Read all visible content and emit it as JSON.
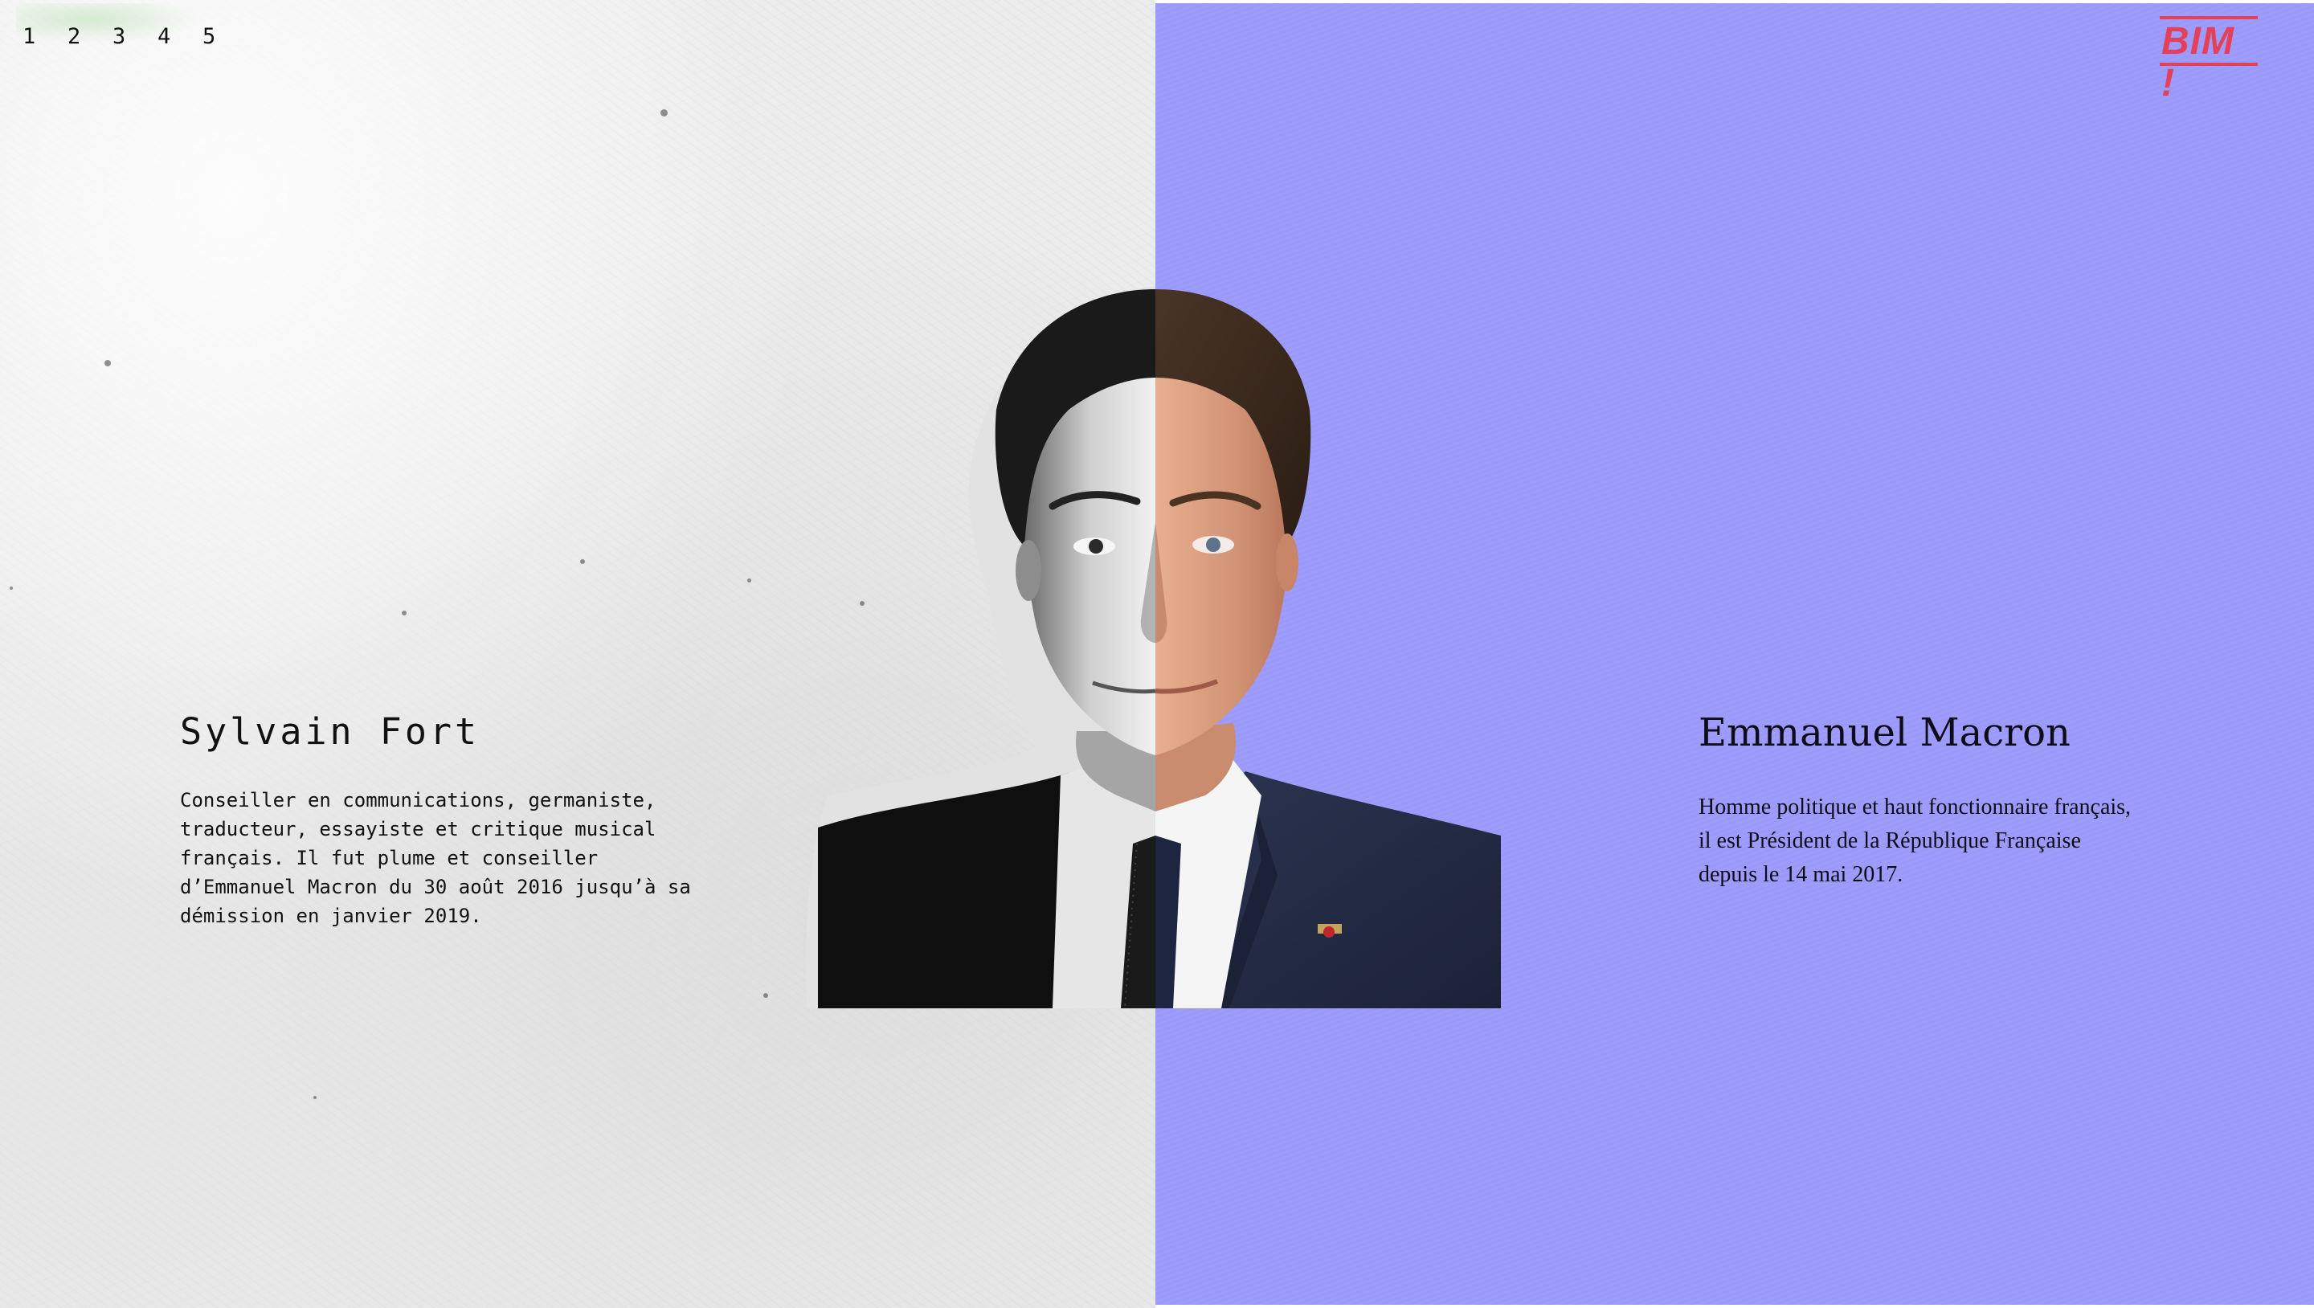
{
  "nav": {
    "pages": [
      "1",
      "2",
      "3",
      "4",
      "5"
    ]
  },
  "logo": {
    "text": "BIM !",
    "color": "#e4405a"
  },
  "left": {
    "name": "Sylvain Fort",
    "bio": "Conseiller en communications, germaniste,\ntraducteur, essayiste et critique musical\nfrançais. Il fut plume et conseiller\nd’Emmanuel Macron du 30 août 2016 jusqu’à sa\ndémission en janvier 2019.",
    "background": "#ececec"
  },
  "right": {
    "name": "Emmanuel Macron",
    "bio": "Homme politique et haut fonctionnaire français,\nil est Président de la République Française\ndepuis le 14 mai 2017.",
    "background": "#9b9afa"
  }
}
